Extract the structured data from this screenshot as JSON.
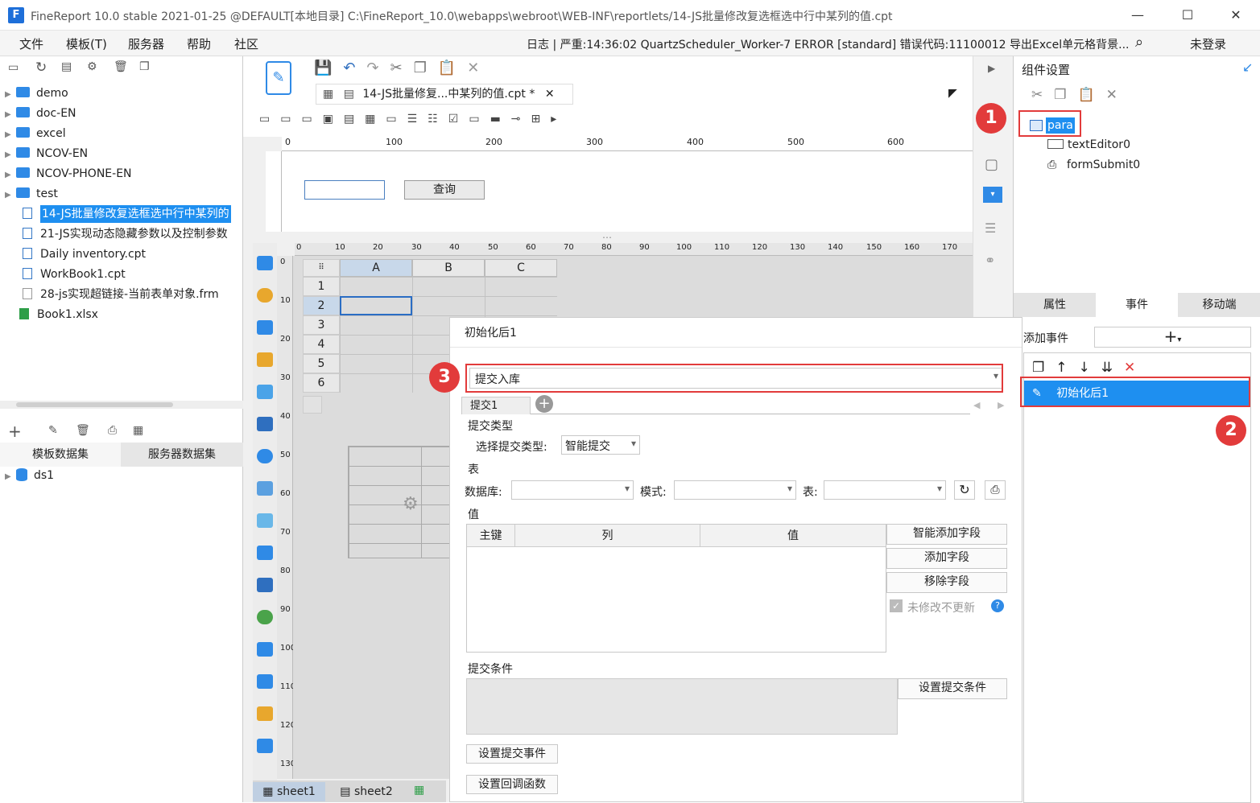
{
  "title_bar": {
    "app_logo": "F",
    "title": "FineReport 10.0 stable 2021-01-25 @DEFAULT[本地目录]    C:\\FineReport_10.0\\webapps\\webroot\\WEB-INF\\reportlets/14-JS批量修改复选框选中行中某列的值.cpt",
    "minimize": "—",
    "maximize": "☐",
    "close": "✕"
  },
  "menu": {
    "items": [
      "文件",
      "模板(T)",
      "服务器",
      "帮助",
      "社区"
    ],
    "log": "日志 | 严重:14:36:02 QuartzScheduler_Worker-7 ERROR [standard] 错误代码:11100012 导出Excel单元格背景...",
    "login": "未登录"
  },
  "file_tree": {
    "folders": [
      "demo",
      "doc-EN",
      "excel",
      "NCOV-EN",
      "NCOV-PHONE-EN",
      "test"
    ],
    "files": [
      "14-JS批量修改复选框选中行中某列的",
      "21-JS实现动态隐藏参数以及控制参数",
      "Daily inventory.cpt",
      "WorkBook1.cpt",
      "28-js实现超链接-当前表单对象.frm",
      "Book1.xlsx"
    ]
  },
  "dataset": {
    "tabs": [
      "模板数据集",
      "服务器数据集"
    ],
    "items": [
      "ds1"
    ]
  },
  "editor": {
    "tab_title": "14-JS批量修复...中某列的值.cpt *",
    "query_button": "查询",
    "ruler_marks": [
      "0",
      "100",
      "200",
      "300",
      "400",
      "500",
      "600"
    ],
    "col_headers": [
      "A",
      "B",
      "C"
    ],
    "row_headers": [
      "1",
      "2",
      "3",
      "4",
      "5",
      "6"
    ],
    "sheet_ruler": [
      "0",
      "10",
      "20",
      "30",
      "40",
      "50",
      "60",
      "70",
      "80",
      "90",
      "100",
      "110",
      "120",
      "130",
      "140",
      "150",
      "160",
      "170"
    ],
    "v_ruler": [
      "0",
      "10",
      "20",
      "30",
      "40",
      "50",
      "60",
      "70",
      "80",
      "90",
      "100",
      "110",
      "120",
      "130"
    ],
    "sheets": [
      "sheet1",
      "sheet2"
    ]
  },
  "component_panel": {
    "title": "组件设置",
    "tree": {
      "root": "para",
      "children": [
        "textEditor0",
        "formSubmit0"
      ]
    },
    "tabs": [
      "属性",
      "事件",
      "移动端"
    ],
    "add_event_label": "添加事件",
    "add_symbol": "+",
    "event_item": "初始化后1"
  },
  "dialog": {
    "title": "初始化后1",
    "action_select": "提交入库",
    "subtab": "提交1",
    "submit_type_section": "提交类型",
    "submit_type_label": "选择提交类型:",
    "submit_type_value": "智能提交",
    "table_section": "表",
    "db_label": "数据库:",
    "schema_label": "模式:",
    "table_label": "表:",
    "value_section": "值",
    "columns": [
      "主键",
      "列",
      "值"
    ],
    "smart_add": "智能添加字段",
    "add_field": "添加字段",
    "remove_field": "移除字段",
    "no_update": "未修改不更新",
    "condition_section": "提交条件",
    "set_condition": "设置提交条件",
    "set_submit_event": "设置提交事件",
    "set_callback": "设置回调函数"
  },
  "annotations": [
    "1",
    "2",
    "3"
  ],
  "colors": {
    "selection": "#1e8ff0",
    "annotation_red": "#e23b3b",
    "folder_blue": "#2f8ae6"
  }
}
